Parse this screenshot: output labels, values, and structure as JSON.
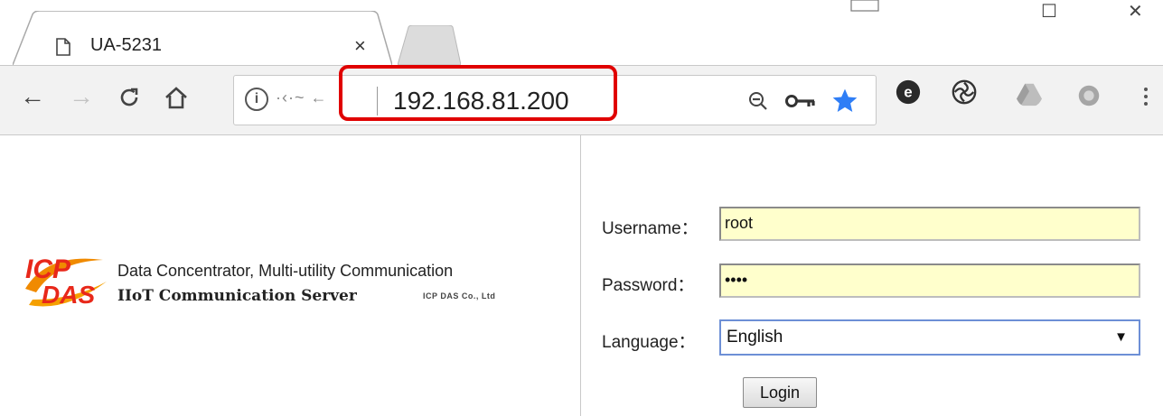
{
  "browser": {
    "tab": {
      "title": "UA-5231",
      "close_glyph": "×"
    },
    "window_controls": {
      "restore": "☐",
      "close": "✕"
    },
    "nav": {
      "back": "←",
      "forward": "→",
      "reload": "C",
      "home": "⌂"
    },
    "address_bar": {
      "info_glyph": "i",
      "faint_text": "·‹·~ ←",
      "url": "192.168.81.200"
    },
    "omnibox_icons": [
      "zoom-out-icon",
      "key-icon",
      "star-icon"
    ],
    "extensions": [
      "e-extension-icon",
      "swirl-extension-icon",
      "drive-extension-icon",
      "gray-extension-icon"
    ],
    "colors": {
      "highlight": "#e00000",
      "star": "#2f7ef6",
      "frame": "#2b63d6"
    }
  },
  "page": {
    "tagline_line1": "Data Concentrator, Multi-utility Communication",
    "tagline_line2": "IIoT Communication Server",
    "company": "ICP DAS Co., Ltd",
    "logo_text": {
      "top": "ICP",
      "bottom": "DAS"
    },
    "form": {
      "username_label": "Username：",
      "username_value": "root",
      "password_label": "Password：",
      "password_value": "••••",
      "language_label": "Language：",
      "language_value": "English",
      "language_arrow": "▼",
      "login_label": "Login"
    }
  }
}
